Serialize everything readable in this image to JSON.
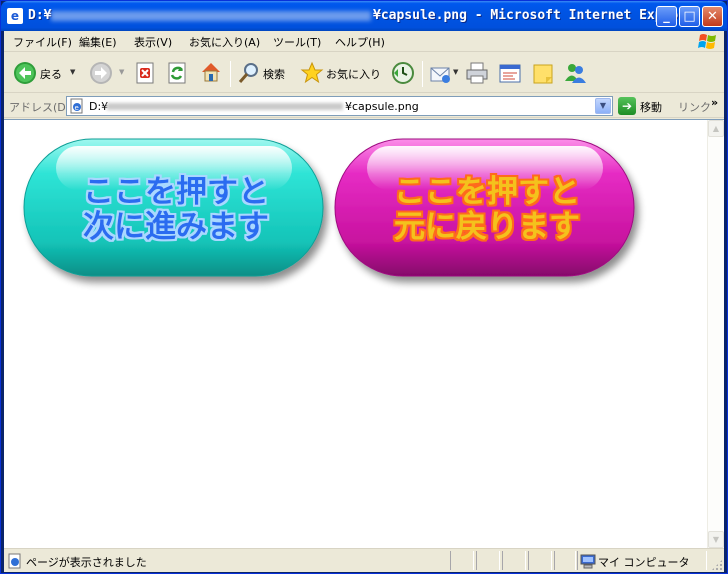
{
  "window": {
    "title_prefix": "D:¥",
    "title_file": "¥capsule.png - Microsoft Internet Explo...",
    "controls": {
      "minimize": "_",
      "maximize": "□",
      "close": "✕"
    }
  },
  "menubar": {
    "items": [
      "ファイル(F)",
      "編集(E)",
      "表示(V)",
      "お気に入り(A)",
      "ツール(T)",
      "ヘルプ(H)"
    ]
  },
  "toolbar": {
    "back_label": "戻る",
    "search_label": "検索",
    "favorites_label": "お気に入り",
    "icons": [
      "back-icon",
      "forward-icon",
      "stop-icon",
      "refresh-icon",
      "home-icon",
      "search-icon",
      "favorites-icon",
      "history-icon",
      "mail-icon",
      "print-icon",
      "edit-icon",
      "discuss-icon",
      "messenger-icon"
    ]
  },
  "addressbar": {
    "label": "アドレス(D)",
    "prefix": "D:¥",
    "file": "¥capsule.png",
    "go_label": "移動",
    "links_label": "リンク",
    "links_chevron": "»"
  },
  "content": {
    "buttons": [
      {
        "line1": "ここを押すと",
        "line2": "次に進みます",
        "color": "#1fd6c9",
        "text_color": "#2a6cf0"
      },
      {
        "line1": "ここを押すと",
        "line2": "元に戻ります",
        "color": "#d81fb6",
        "text_color": "#f4c21c"
      }
    ]
  },
  "statusbar": {
    "text": "ページが表示されました",
    "zone": "マイ コンピュータ"
  },
  "colors": {
    "titlebar": "#0054e3",
    "chrome": "#ece9d8",
    "content_bg": "#ffffff"
  }
}
